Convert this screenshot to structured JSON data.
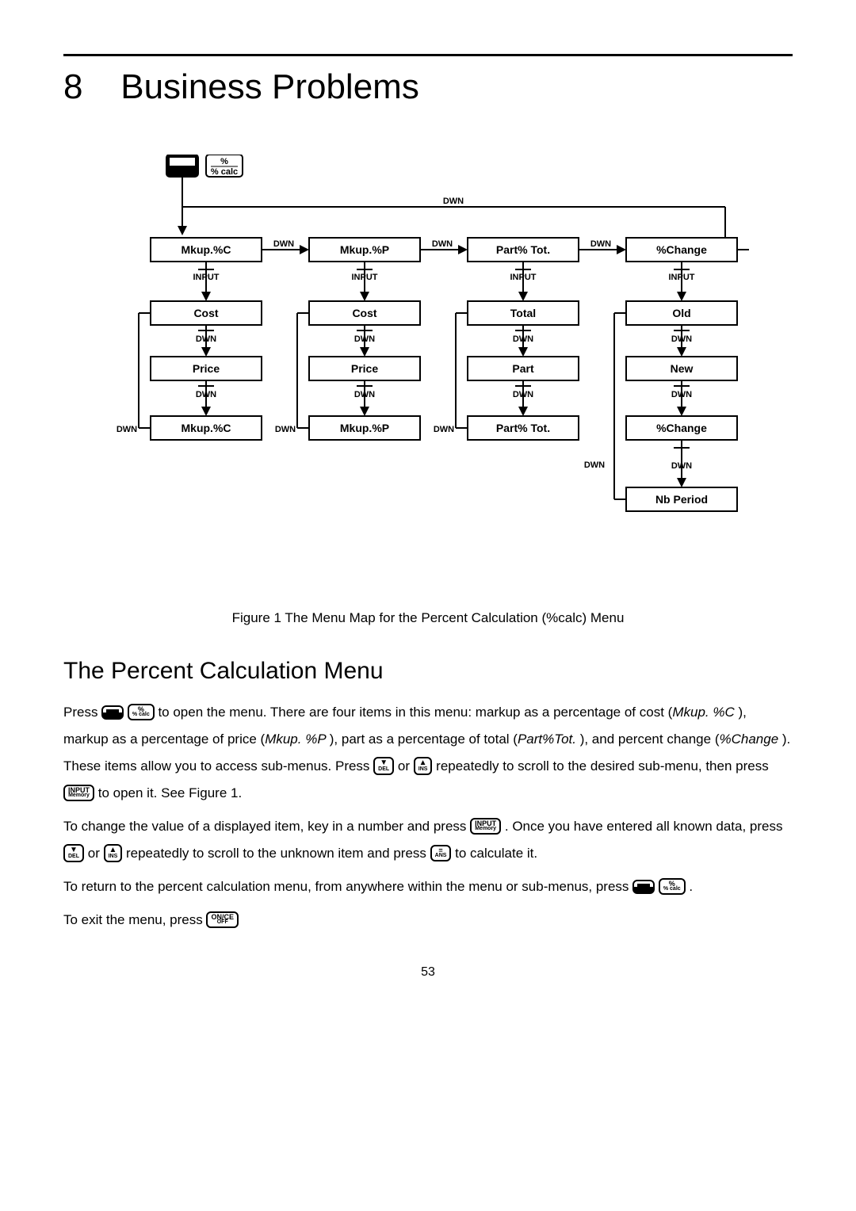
{
  "chapter_num": "8",
  "chapter_title": "Business Problems",
  "figure_caption": "Figure 1 The Menu Map for the Percent Calculation (%calc) Menu",
  "section_title": "The Percent Calculation Menu",
  "para1_a": "Press ",
  "para1_b": " to open the menu. There are four items in this menu: markup as a percentage of cost (",
  "para1_c": "Mkup. %C ",
  "para1_d": "), markup as a percentage of price (",
  "para1_e": "Mkup. %P ",
  "para1_f": "), part as a percentage of total (",
  "para1_g": "Part%Tot. ",
  "para1_h": "), and percent change (",
  "para1_i": "%Change ",
  "para1_j": "). These items allow you to access sub-menus. Press ",
  "para1_k": " or ",
  "para1_l": " repeatedly to scroll to the desired sub-menu, then press ",
  "para1_m": " to open it. See Figure 1.",
  "para2_a": "To change the value of a displayed item, key in a number and press ",
  "para2_b": ". Once you have entered all known data, press ",
  "para2_c": " or ",
  "para2_d": " repeatedly to scroll to the unknown item and press ",
  "para2_e": " to calculate it.",
  "para3_a": "To return to the percent calculation menu, from anywhere within the menu or sub-menus, press ",
  "para3_b": ".",
  "para4_a": "To exit the menu, press ",
  "key_pct_top": "%",
  "key_pct_bot": "% calc",
  "key_input_top": "INPUT",
  "key_input_bot": "Memory",
  "key_down_top": "▼",
  "key_down_bot": "DEL",
  "key_up_top": "▲",
  "key_up_bot": "INS",
  "key_eq_top": "=",
  "key_eq_bot": "ANS",
  "key_once_top": "ON/CE",
  "key_once_bot": "OFF",
  "page_number": "53",
  "diagram": {
    "top_labels": {
      "pct": "%",
      "pct_sub": "% calc"
    },
    "col1": [
      "Mkup.%C",
      "Cost",
      "Price",
      "Mkup.%C"
    ],
    "col2": [
      "Mkup.%P",
      "Cost",
      "Price",
      "Mkup.%P"
    ],
    "col3": [
      "Part% Tot.",
      "Total",
      "Part",
      "Part% Tot."
    ],
    "col4": [
      "%Change",
      "Old",
      "New",
      "%Change",
      "Nb  Period"
    ],
    "edge_h": "DWN",
    "edge_v_input": "INPUT",
    "edge_v_dwn": "DWN"
  }
}
